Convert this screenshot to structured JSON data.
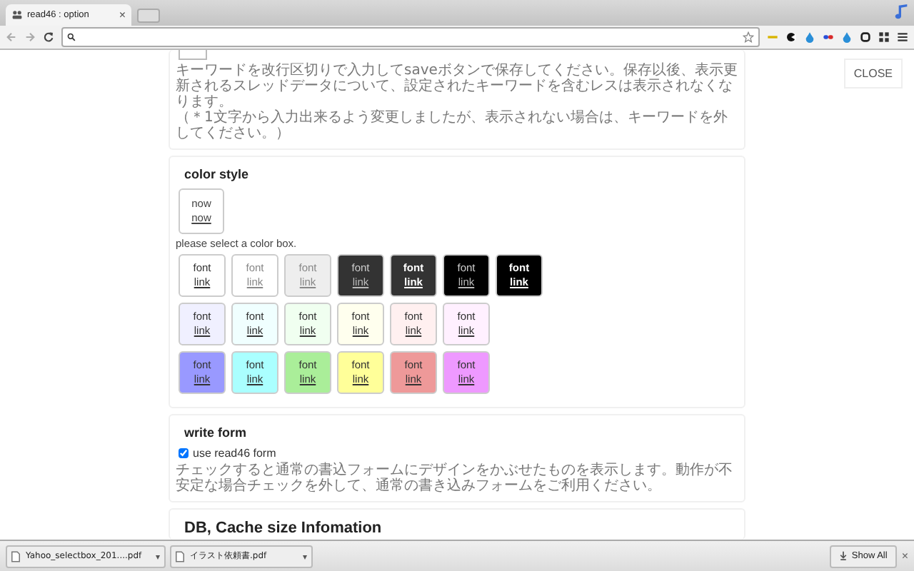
{
  "browser": {
    "tab_title": "read46 : option",
    "tab_close": "×"
  },
  "close_button": "CLOSE",
  "keyword_section": {
    "notes": [
      "キーワードを改行区切りで入力してsaveボタンで保存してください。保存以後、表示更新されるスレッドデータについて、設定されたキーワードを含むレスは表示されなくなります。",
      "（＊1文字から入力出来るよう変更しましたが、表示されない場合は、キーワードを外してください。）"
    ]
  },
  "color_style": {
    "title": "color style",
    "current": {
      "font": "now",
      "link": "now"
    },
    "hint": "please select a color box.",
    "rows": [
      [
        {
          "font": "font",
          "link": "link",
          "color": "#ffffff",
          "kind": "plain"
        },
        {
          "font": "font",
          "link": "link",
          "color": "#ffffff",
          "kind": "faded"
        },
        {
          "font": "font",
          "link": "link",
          "color": "#eeeeee",
          "kind": "faded"
        },
        {
          "font": "font",
          "link": "link",
          "color": "#333333",
          "kind": "dark"
        },
        {
          "font": "font",
          "link": "link",
          "color": "#333333",
          "kind": "bright"
        },
        {
          "font": "font",
          "link": "link",
          "color": "#000000",
          "kind": "dark"
        },
        {
          "font": "font",
          "link": "link",
          "color": "#000000",
          "kind": "bright"
        }
      ],
      [
        {
          "font": "font",
          "link": "link",
          "color": "#f0f0ff",
          "kind": "plain"
        },
        {
          "font": "font",
          "link": "link",
          "color": "#f0ffff",
          "kind": "plain"
        },
        {
          "font": "font",
          "link": "link",
          "color": "#f0fff0",
          "kind": "plain"
        },
        {
          "font": "font",
          "link": "link",
          "color": "#ffffee",
          "kind": "plain"
        },
        {
          "font": "font",
          "link": "link",
          "color": "#fff0f0",
          "kind": "plain"
        },
        {
          "font": "font",
          "link": "link",
          "color": "#fff0ff",
          "kind": "plain"
        }
      ],
      [
        {
          "font": "font",
          "link": "link",
          "color": "#9999ff",
          "kind": "plain"
        },
        {
          "font": "font",
          "link": "link",
          "color": "#aaffff",
          "kind": "plain"
        },
        {
          "font": "font",
          "link": "link",
          "color": "#aaee99",
          "kind": "plain"
        },
        {
          "font": "font",
          "link": "link",
          "color": "#ffff99",
          "kind": "plain"
        },
        {
          "font": "font",
          "link": "link",
          "color": "#ee9999",
          "kind": "plain"
        },
        {
          "font": "font",
          "link": "link",
          "color": "#ee99ff",
          "kind": "plain"
        }
      ]
    ]
  },
  "write_form": {
    "title": "write form",
    "option": {
      "label": "use read46 form",
      "checked": true
    },
    "note": "チェックすると通常の書込フォームにデザインをかぶせたものを表示します。動作が不安定な場合チェックを外して、通常の書き込みフォームをご利用ください。"
  },
  "db_section": {
    "title": "DB, Cache size Infomation"
  },
  "downloads": {
    "items": [
      {
        "name": "Yahoo_selectbox_201....pdf",
        "caret": "▾"
      },
      {
        "name": "イラスト依頼書.pdf",
        "caret": "▾"
      }
    ],
    "show_all": "Show All",
    "close": "×"
  }
}
